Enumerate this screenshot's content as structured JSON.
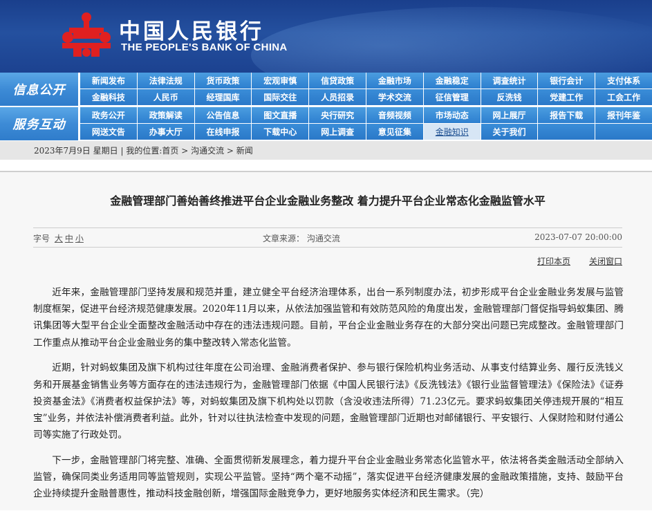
{
  "header": {
    "logo_cn": "中国人民银行",
    "logo_en": "THE PEOPLE'S BANK OF CHINA",
    "logo_color": "#e02020",
    "background": "#1f4a96"
  },
  "nav": {
    "sections": [
      {
        "title": "信息公开",
        "row1": [
          "新闻发布",
          "法律法规",
          "货币政策",
          "宏观审慎",
          "信贷政策",
          "金融市场",
          "金融稳定",
          "调查统计",
          "银行会计",
          "支付体系"
        ],
        "row2": [
          "金融科技",
          "人民币",
          "经理国库",
          "国际交往",
          "人员招录",
          "学术交流",
          "征信管理",
          "反洗钱",
          "党建工作",
          "工会工作"
        ]
      },
      {
        "title": "服务互动",
        "row1": [
          "政务公开",
          "政策解读",
          "公告信息",
          "图文直播",
          "央行研究",
          "音频视频",
          "市场动态",
          "网上展厅",
          "报告下载",
          "报刊年鉴"
        ],
        "row2": [
          "网送文告",
          "办事大厅",
          "在线申报",
          "下载中心",
          "网上调查",
          "意见征集",
          "金融知识",
          "关于我们"
        ]
      }
    ],
    "active_item": "金融知识"
  },
  "breadcrumb": {
    "date": "2023年7月9日 星期日",
    "location_label": "我的位置:",
    "crumbs": [
      "首页",
      "沟通交流",
      "新闻"
    ]
  },
  "article": {
    "title": "金融管理部门善始善终推进平台企业金融业务整改 着力提升平台企业常态化金融监管水平",
    "font_size_label": "字号",
    "font_sizes": [
      "大",
      "中",
      "小"
    ],
    "source": "文章来源：  沟通交流",
    "datetime": "2023-07-07 20:00:00",
    "print_label": "打印本页",
    "close_label": "关闭窗口",
    "paragraphs": [
      "近年来，金融管理部门坚持发展和规范并重，建立健全平台经济治理体系，出台一系列制度办法，初步形成平台企业金融业务发展与监管制度框架，促进平台经济规范健康发展。2020年11月以来，从依法加强监管和有效防范风险的角度出发，金融管理部门督促指导蚂蚁集团、腾讯集团等大型平台企业全面整改金融活动中存在的违法违规问题。目前，平台企业金融业务存在的大部分突出问题已完成整改。金融管理部门工作重点从推动平台企业金融业务的集中整改转入常态化监管。",
      "近期，针对蚂蚁集团及旗下机构过往年度在公司治理、金融消费者保护、参与银行保险机构业务活动、从事支付结算业务、履行反洗钱义务和开展基金销售业务等方面存在的违法违规行为，金融管理部门依据《中国人民银行法》《反洗钱法》《银行业监督管理法》《保险法》《证券投资基金法》《消费者权益保护法》等，对蚂蚁集团及旗下机构处以罚款（含没收违法所得）71.23亿元。要求蚂蚁集团关停违规开展的“相互宝”业务，并依法补偿消费者利益。此外，针对以往执法检查中发现的问题，金融管理部门近期也对邮储银行、平安银行、人保财险和财付通公司等实施了行政处罚。",
      "下一步，金融管理部门将完整、准确、全面贯彻新发展理念，着力提升平台企业金融业务常态化监管水平，依法将各类金融活动全部纳入监管，确保同类业务适用同等监管规则，实现公平监管。坚持“两个毫不动摇”，落实促进平台经济健康发展的金融政策措施，支持、鼓励平台企业持续提升金融普惠性，推动科技金融创新，增强国际金融竞争力，更好地服务实体经济和民生需求。（完）"
    ]
  }
}
